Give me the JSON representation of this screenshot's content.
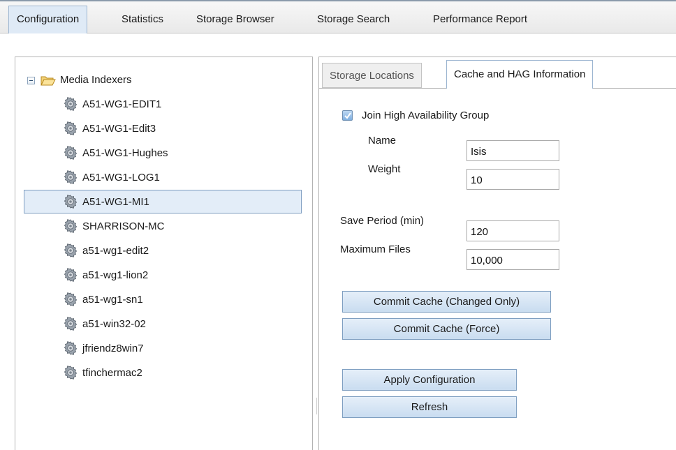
{
  "top_tabs": [
    {
      "label": "Configuration",
      "active": true
    },
    {
      "label": "Statistics"
    },
    {
      "label": "Storage Browser"
    },
    {
      "label": "Storage Search"
    },
    {
      "label": "Performance Report"
    }
  ],
  "tree": {
    "root_label": "Media Indexers",
    "items": [
      {
        "label": "A51-WG1-EDIT1"
      },
      {
        "label": "A51-WG1-Edit3"
      },
      {
        "label": "A51-WG1-Hughes"
      },
      {
        "label": "A51-WG1-LOG1"
      },
      {
        "label": "A51-WG1-MI1",
        "selected": true
      },
      {
        "label": "SHARRISON-MC"
      },
      {
        "label": "a51-wg1-edit2"
      },
      {
        "label": "a51-wg1-lion2"
      },
      {
        "label": "a51-wg1-sn1"
      },
      {
        "label": "a51-win32-02"
      },
      {
        "label": "jfriendz8win7"
      },
      {
        "label": "tfinchermac2"
      }
    ]
  },
  "sub_tabs": [
    {
      "label": "Storage Locations",
      "active": false
    },
    {
      "label": "Cache and HAG Information",
      "active": true
    }
  ],
  "hag": {
    "join_label": "Join High Availability Group",
    "join_checked": true,
    "name_label": "Name",
    "name_value": "Isis",
    "weight_label": "Weight",
    "weight_value": "10"
  },
  "cache": {
    "save_period_label": "Save Period (min)",
    "save_period_value": "120",
    "max_files_label": "Maximum Files",
    "max_files_value": "10,000"
  },
  "buttons": {
    "commit_changed": "Commit Cache (Changed Only)",
    "commit_force": "Commit Cache (Force)",
    "apply": "Apply Configuration",
    "refresh": "Refresh"
  },
  "icons": {
    "expander": "collapse-icon",
    "folder": "folder-open-icon",
    "node": "gear-icon"
  },
  "colors": {
    "accent": "#dfeaf6",
    "selection": "#e3edf8",
    "button": "#c9dcf0"
  }
}
